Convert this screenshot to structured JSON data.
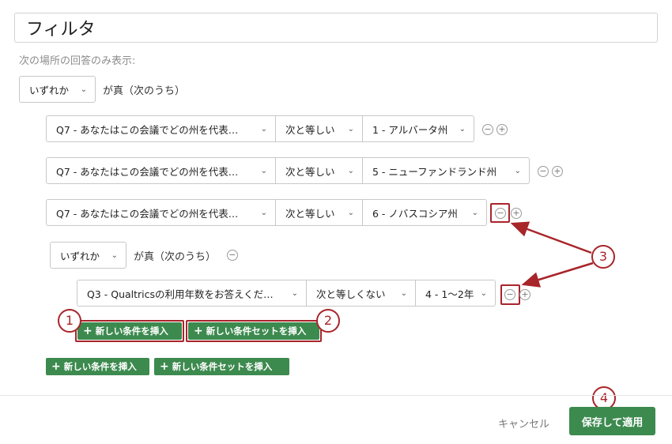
{
  "title": "フィルタ",
  "subtitle": "次の場所の回答のみ表示:",
  "root_group": {
    "condition_value": "いずれか",
    "suffix": "が真（次のうち）"
  },
  "conditions": [
    {
      "question": "Q7 - あなたはこの会議でどの州を代表…",
      "operator": "次と等しい",
      "value": "1 - アルバータ州"
    },
    {
      "question": "Q7 - あなたはこの会議でどの州を代表…",
      "operator": "次と等しい",
      "value": "5 - ニューファンドランド州"
    },
    {
      "question": "Q7 - あなたはこの会議でどの州を代表…",
      "operator": "次と等しい",
      "value": "6 - ノバスコシア州"
    }
  ],
  "nested_group": {
    "condition_value": "いずれか",
    "suffix": "が真（次のうち）",
    "conditions": [
      {
        "question": "Q3 - Qualtricsの利用年数をお答えくだ…",
        "operator": "次と等しくない",
        "value": "4 - 1～2年"
      }
    ],
    "insert_condition_label": "新しい条件を挿入",
    "insert_condition_set_label": "新しい条件セットを挿入"
  },
  "root_actions": {
    "insert_condition_label": "新しい条件を挿入",
    "insert_condition_set_label": "新しい条件セットを挿入"
  },
  "icons": {
    "chevron": "chevron-down-icon",
    "remove": "minus-circle-icon",
    "add": "plus-circle-icon",
    "insert": "plus-icon"
  },
  "glyphs": {
    "chevron": "⌄",
    "minus": "−",
    "plus": "+"
  },
  "callouts": [
    "1",
    "2",
    "3",
    "4"
  ],
  "footer": {
    "cancel_label": "キャンセル",
    "save_label": "保存して適用"
  },
  "colors": {
    "accent_green": "#3d8a4f",
    "annotation_red": "#a8252a"
  }
}
